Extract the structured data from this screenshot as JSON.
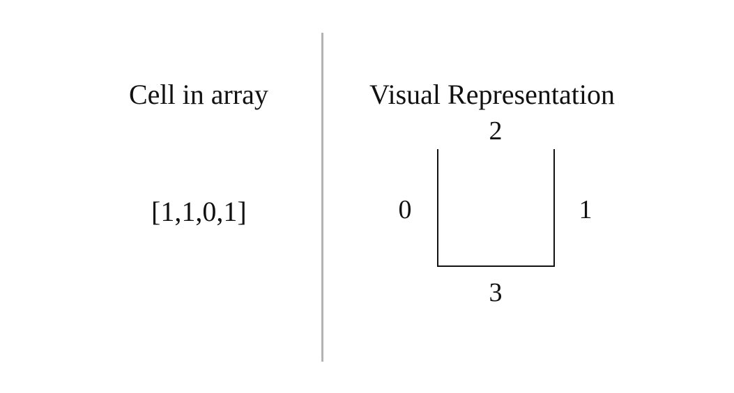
{
  "headings": {
    "left": "Cell in array",
    "right": "Visual Representation"
  },
  "array_value": "[1,1,0,1]",
  "side_labels": {
    "top": "2",
    "left": "0",
    "right": "1",
    "bottom": "3"
  },
  "walls": {
    "left": true,
    "right": true,
    "top": false,
    "bottom": true
  }
}
